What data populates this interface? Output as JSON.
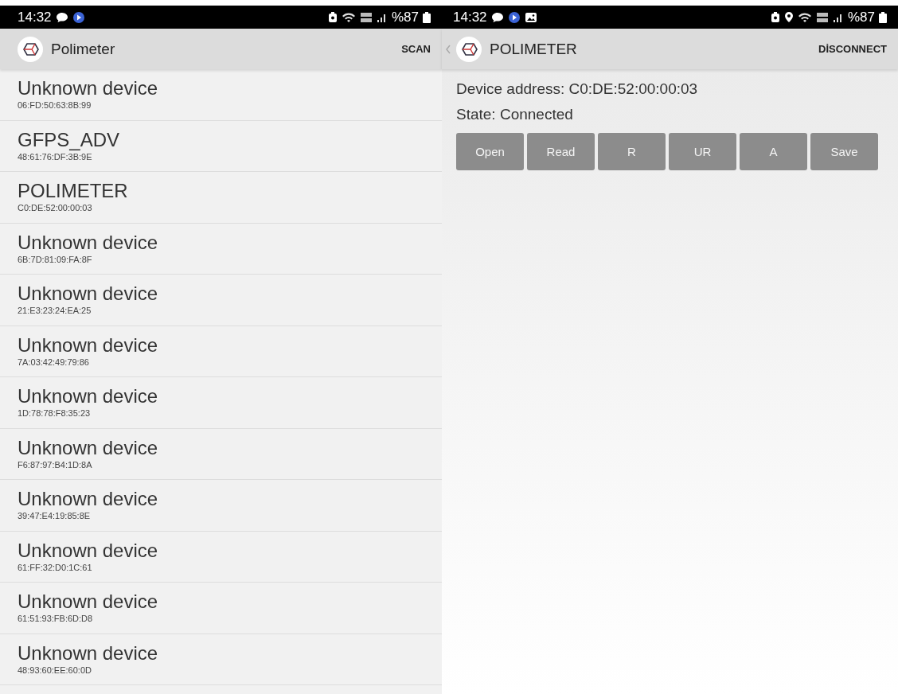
{
  "screens": [
    {
      "status_bar": {
        "time": "14:32",
        "battery": "%87"
      },
      "app_bar": {
        "title": "Polimeter",
        "action": "SCAN"
      },
      "devices": [
        {
          "name": "Unknown device",
          "address": "06:FD:50:63:8B:99"
        },
        {
          "name": "GFPS_ADV",
          "address": "48:61:76:DF:3B:9E"
        },
        {
          "name": "POLIMETER",
          "address": "C0:DE:52:00:00:03"
        },
        {
          "name": "Unknown device",
          "address": "6B:7D:81:09:FA:8F"
        },
        {
          "name": "Unknown device",
          "address": "21:E3:23:24:EA:25"
        },
        {
          "name": "Unknown device",
          "address": "7A:03:42:49:79:86"
        },
        {
          "name": "Unknown device",
          "address": "1D:78:78:F8:35:23"
        },
        {
          "name": "Unknown device",
          "address": "F6:87:97:B4:1D:8A"
        },
        {
          "name": "Unknown device",
          "address": "39:47:E4:19:85:8E"
        },
        {
          "name": "Unknown device",
          "address": "61:FF:32:D0:1C:61"
        },
        {
          "name": "Unknown device",
          "address": "61:51:93:FB:6D:D8"
        },
        {
          "name": "Unknown device",
          "address": "48:93:60:EE:60:0D"
        }
      ]
    },
    {
      "status_bar": {
        "time": "14:32",
        "battery": "%87"
      },
      "app_bar": {
        "title": "POLIMETER",
        "action": "DİSCONNECT"
      },
      "device_address": "Device address: C0:DE:52:00:00:03",
      "state": "State: Connected",
      "buttons": [
        "Open",
        "Read",
        "R",
        "UR",
        "A",
        "Save"
      ]
    }
  ]
}
